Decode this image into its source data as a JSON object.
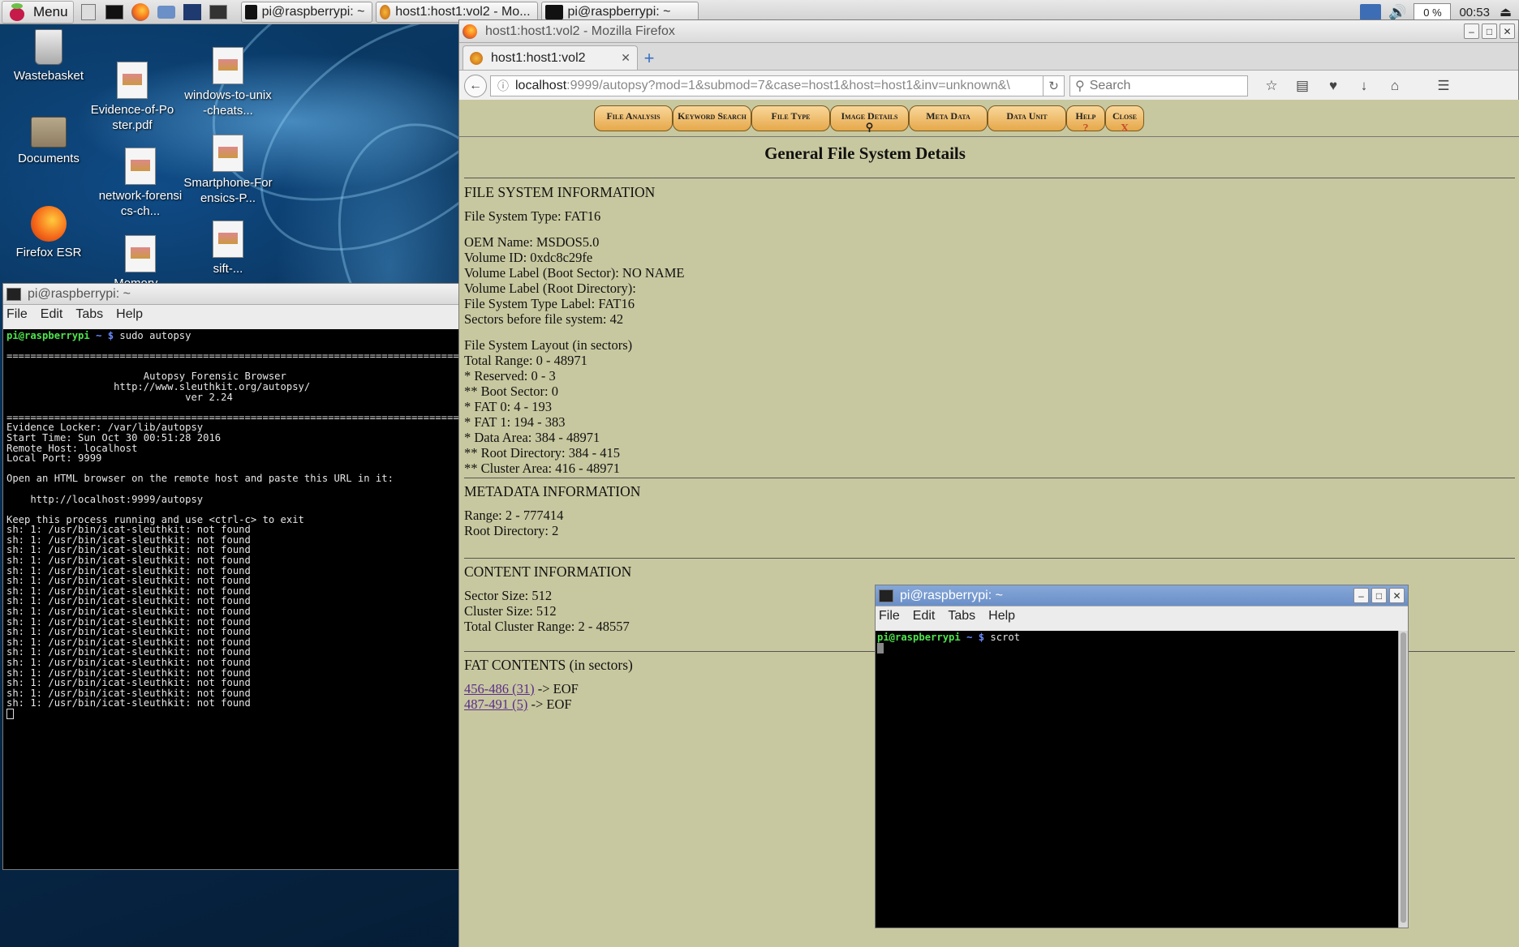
{
  "taskbar": {
    "menu_label": "Menu",
    "tasks": [
      {
        "label": "pi@raspberrypi: ~"
      },
      {
        "label": "host1:host1:vol2 - Mo..."
      },
      {
        "label": "pi@raspberrypi: ~"
      }
    ],
    "cpu": "0 %",
    "clock": "00:53"
  },
  "desktop_icons": [
    {
      "label": "Wastebasket"
    },
    {
      "label": "Documents"
    },
    {
      "label": "Firefox ESR"
    },
    {
      "label": "Evidence-of-Poster.pdf"
    },
    {
      "label": "network-forensics-ch..."
    },
    {
      "label": "Memory..."
    },
    {
      "label": "windows-to-unix-cheats..."
    },
    {
      "label": "Smartphone-Forensics-P..."
    },
    {
      "label": "sift-..."
    }
  ],
  "term1": {
    "title": "pi@raspberrypi: ~",
    "menu": [
      "File",
      "Edit",
      "Tabs",
      "Help"
    ],
    "prompt_user": "pi@raspberrypi",
    "prompt_rest": " ~ $ ",
    "command": "sudo autopsy",
    "lines": [
      "",
      "============================================================================",
      "",
      "                       Autopsy Forensic Browser",
      "                  http://www.sleuthkit.org/autopsy/",
      "                              ver 2.24",
      "",
      "============================================================================",
      "Evidence Locker: /var/lib/autopsy",
      "Start Time: Sun Oct 30 00:51:28 2016",
      "Remote Host: localhost",
      "Local Port: 9999",
      "",
      "Open an HTML browser on the remote host and paste this URL in it:",
      "",
      "    http://localhost:9999/autopsy",
      "",
      "Keep this process running and use <ctrl-c> to exit",
      "sh: 1: /usr/bin/icat-sleuthkit: not found",
      "sh: 1: /usr/bin/icat-sleuthkit: not found",
      "sh: 1: /usr/bin/icat-sleuthkit: not found",
      "sh: 1: /usr/bin/icat-sleuthkit: not found",
      "sh: 1: /usr/bin/icat-sleuthkit: not found",
      "sh: 1: /usr/bin/icat-sleuthkit: not found",
      "sh: 1: /usr/bin/icat-sleuthkit: not found",
      "sh: 1: /usr/bin/icat-sleuthkit: not found",
      "sh: 1: /usr/bin/icat-sleuthkit: not found",
      "sh: 1: /usr/bin/icat-sleuthkit: not found",
      "sh: 1: /usr/bin/icat-sleuthkit: not found",
      "sh: 1: /usr/bin/icat-sleuthkit: not found",
      "sh: 1: /usr/bin/icat-sleuthkit: not found",
      "sh: 1: /usr/bin/icat-sleuthkit: not found",
      "sh: 1: /usr/bin/icat-sleuthkit: not found",
      "sh: 1: /usr/bin/icat-sleuthkit: not found",
      "sh: 1: /usr/bin/icat-sleuthkit: not found",
      "sh: 1: /usr/bin/icat-sleuthkit: not found"
    ]
  },
  "firefox": {
    "title": "host1:host1:vol2 - Mozilla Firefox",
    "tab_label": "host1:host1:vol2",
    "url_host": "localhost",
    "url_rest": ":9999/autopsy?mod=1&submod=7&case=host1&host=host1&inv=unknown&\\",
    "search_placeholder": "Search"
  },
  "autopsy": {
    "menu": [
      "File Analysis",
      "Keyword Search",
      "File Type",
      "Image Details",
      "Meta Data",
      "Data Unit",
      "Help",
      "Close"
    ],
    "help_icon": "?",
    "close_icon": "X",
    "page_title": "General File System Details",
    "fs_heading": "FILE SYSTEM INFORMATION",
    "fs_type": "File System Type: FAT16",
    "fs_block1": [
      "OEM Name: MSDOS5.0",
      "Volume ID: 0xdc8c29fe",
      "Volume Label (Boot Sector): NO NAME",
      "Volume Label (Root Directory):",
      "File System Type Label: FAT16"
    ],
    "sectors_before": "Sectors before file system: 42",
    "layout": [
      "File System Layout (in sectors)",
      "Total Range: 0 - 48971",
      "* Reserved: 0 - 3",
      "** Boot Sector: 0",
      "* FAT 0: 4 - 193",
      "* FAT 1: 194 - 383",
      "* Data Area: 384 - 48971",
      "** Root Directory: 384 - 415",
      "** Cluster Area: 416 - 48971"
    ],
    "meta_heading": "METADATA INFORMATION",
    "meta": [
      "Range: 2 - 777414",
      "Root Directory: 2"
    ],
    "content_heading": "CONTENT INFORMATION",
    "content": [
      "Sector Size: 512",
      "Cluster Size: 512",
      "Total Cluster Range: 2 - 48557"
    ],
    "fat_heading": "FAT CONTENTS (in sectors)",
    "fat_entries": [
      {
        "link": "456-486 (31)",
        "rest": " -> EOF"
      },
      {
        "link": "487-491 (5)",
        "rest": " -> EOF"
      }
    ]
  },
  "term2": {
    "title": "pi@raspberrypi: ~",
    "menu": [
      "File",
      "Edit",
      "Tabs",
      "Help"
    ],
    "prompt_user": "pi@raspberrypi",
    "prompt_rest": " ~ $ ",
    "command": "scrot"
  }
}
